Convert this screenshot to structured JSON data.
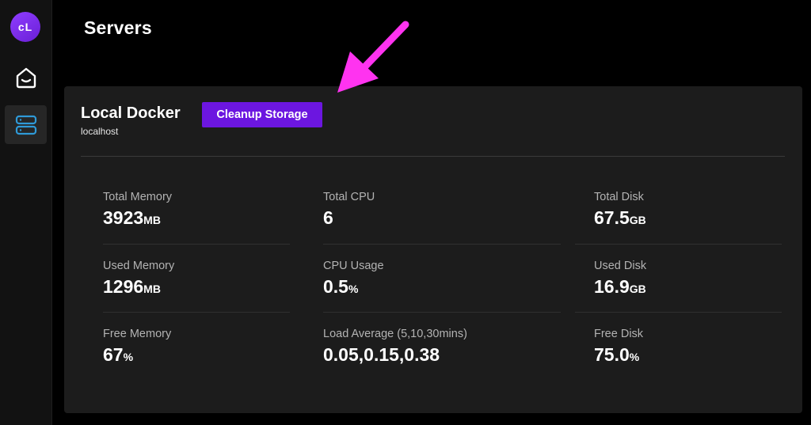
{
  "sidebar": {
    "avatar_text": "cL",
    "items": [
      {
        "name": "home",
        "icon": "home-icon"
      },
      {
        "name": "servers",
        "icon": "servers-icon",
        "active": true
      }
    ]
  },
  "page": {
    "title": "Servers"
  },
  "server": {
    "name": "Local Docker",
    "host": "localhost",
    "cleanup_label": "Cleanup Storage"
  },
  "stats": {
    "total_memory": {
      "label": "Total Memory",
      "value": "3923",
      "unit": "MB"
    },
    "used_memory": {
      "label": "Used Memory",
      "value": "1296",
      "unit": "MB"
    },
    "free_memory": {
      "label": "Free Memory",
      "value": "67",
      "unit": "%"
    },
    "total_cpu": {
      "label": "Total CPU",
      "value": "6",
      "unit": ""
    },
    "cpu_usage": {
      "label": "CPU Usage",
      "value": "0.5",
      "unit": "%"
    },
    "load_average": {
      "label": "Load Average (5,10,30mins)",
      "value": "0.05,0.15,0.38",
      "unit": ""
    },
    "total_disk": {
      "label": "Total Disk",
      "value": "67.5",
      "unit": "GB"
    },
    "used_disk": {
      "label": "Used Disk",
      "value": "16.9",
      "unit": "GB"
    },
    "free_disk": {
      "label": "Free Disk",
      "value": "75.0",
      "unit": "%"
    }
  },
  "colors": {
    "accent": "#6c16e0",
    "annotation_arrow": "#ff33f0",
    "icon_blue": "#2f9ad8"
  }
}
